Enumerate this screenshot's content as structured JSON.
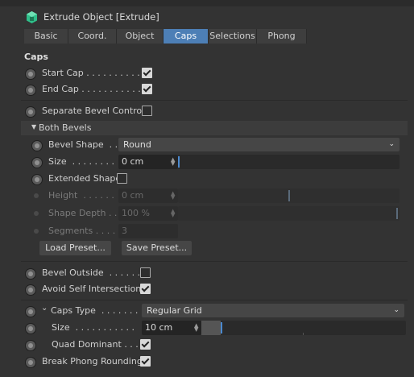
{
  "header": {
    "title": "Extrude Object [Extrude]",
    "icon": "extrude-object-icon",
    "accent": "#4d7fb6"
  },
  "tabs": [
    {
      "label": "Basic"
    },
    {
      "label": "Coord."
    },
    {
      "label": "Object"
    },
    {
      "label": "Caps",
      "active": true
    },
    {
      "label": "Selections"
    },
    {
      "label": "Phong"
    }
  ],
  "caps": {
    "section_title": "Caps",
    "start_cap": {
      "label": "Start Cap . . . . . . . . . .",
      "checked": true
    },
    "end_cap": {
      "label": "End Cap . . . . . . . . . . .",
      "checked": true
    },
    "separate_bevel": {
      "label": "Separate Bevel Controls",
      "checked": false
    },
    "both_bevels": {
      "label": "Both Bevels",
      "bevel_shape": {
        "label": "Bevel Shape  . .",
        "value": "Round"
      },
      "size": {
        "label": "Size  . . . . . . . .",
        "value": "0 cm",
        "fraction": 0.0
      },
      "extended_shape": {
        "label": "Extended Shape",
        "checked": false
      },
      "height": {
        "label": "Height  . . . . . .",
        "value": "0 cm",
        "fraction": 0.5
      },
      "shape_depth": {
        "label": "Shape Depth . .",
        "value": "100 %",
        "fraction": 1.0
      },
      "segments": {
        "label": "Segments . . . .",
        "value": "3"
      },
      "load_preset": "Load Preset...",
      "save_preset": "Save Preset..."
    },
    "bevel_outside": {
      "label": "Bevel Outside  . . . . . .",
      "checked": false
    },
    "avoid_self": {
      "label": "Avoid Self Intersections",
      "checked": true
    },
    "caps_type": {
      "label": "Caps Type  . . . . . . .",
      "value": "Regular Grid"
    },
    "grid_size": {
      "label": "Size  . . . . . . . . . . .",
      "value": "10 cm",
      "fraction": 0.1
    },
    "quad_dominant": {
      "label": "Quad Dominant . . .",
      "checked": true
    },
    "break_phong": {
      "label": "Break Phong Rounding",
      "checked": true
    }
  }
}
